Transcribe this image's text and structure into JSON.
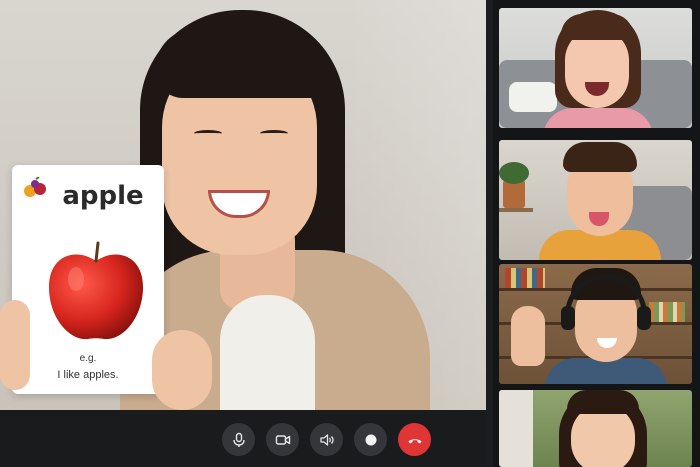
{
  "flashcard": {
    "word": "apple",
    "example_prefix": "e.g.",
    "example_sentence": "I like apples.",
    "logo_icon": "fruit-basket-icon",
    "apple_color": "#d8261e"
  },
  "controls": {
    "mic_icon": "microphone-icon",
    "camera_icon": "video-camera-icon",
    "speaker_icon": "speaker-icon",
    "record_icon": "record-dot-icon",
    "end_call_icon": "hang-up-icon",
    "end_call_color": "#e03535"
  },
  "participants": [
    {
      "tile": "participant-tile-1",
      "shirt_color": "#e89aa8"
    },
    {
      "tile": "participant-tile-2",
      "shirt_color": "#e8a23b"
    },
    {
      "tile": "participant-tile-3",
      "shirt_color": "#3f5a78"
    },
    {
      "tile": "participant-tile-4",
      "shirt_color": "#f1dcc8"
    }
  ]
}
